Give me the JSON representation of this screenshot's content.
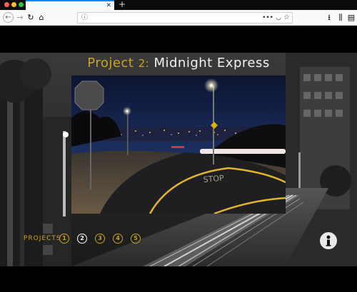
{
  "browser": {
    "tab_close_glyph": "✕",
    "new_tab_glyph": "+",
    "url": "",
    "icons": {
      "back": "back-arrow-icon",
      "forward": "forward-arrow-icon",
      "reload": "reload-icon",
      "home": "home-icon",
      "info": "info-icon",
      "more": "more-icon",
      "pocket": "pocket-icon",
      "bookmark": "star-icon",
      "downloads": "download-icon",
      "library": "library-icon",
      "sidebar": "sidebar-icon"
    },
    "glyphs": {
      "back": "←",
      "forward": "→",
      "reload": "↻",
      "home": "⌂",
      "info": "ⓘ",
      "more": "•••",
      "pocket": "◡",
      "bookmark": "☆",
      "downloads": "⭳",
      "library": "⫼",
      "sidebar": "▤"
    }
  },
  "page": {
    "title_project_word": "Project",
    "title_number": "2:",
    "title_name": "Midnight Express",
    "projects_label": "PROJECTS",
    "project_buttons": [
      "1",
      "2",
      "3",
      "4",
      "5"
    ],
    "active_project": "2",
    "info_icon": "person-info-icon",
    "colors": {
      "accent_gold": "#c9a227",
      "active_white": "#ffffff",
      "background": "#000000"
    }
  }
}
